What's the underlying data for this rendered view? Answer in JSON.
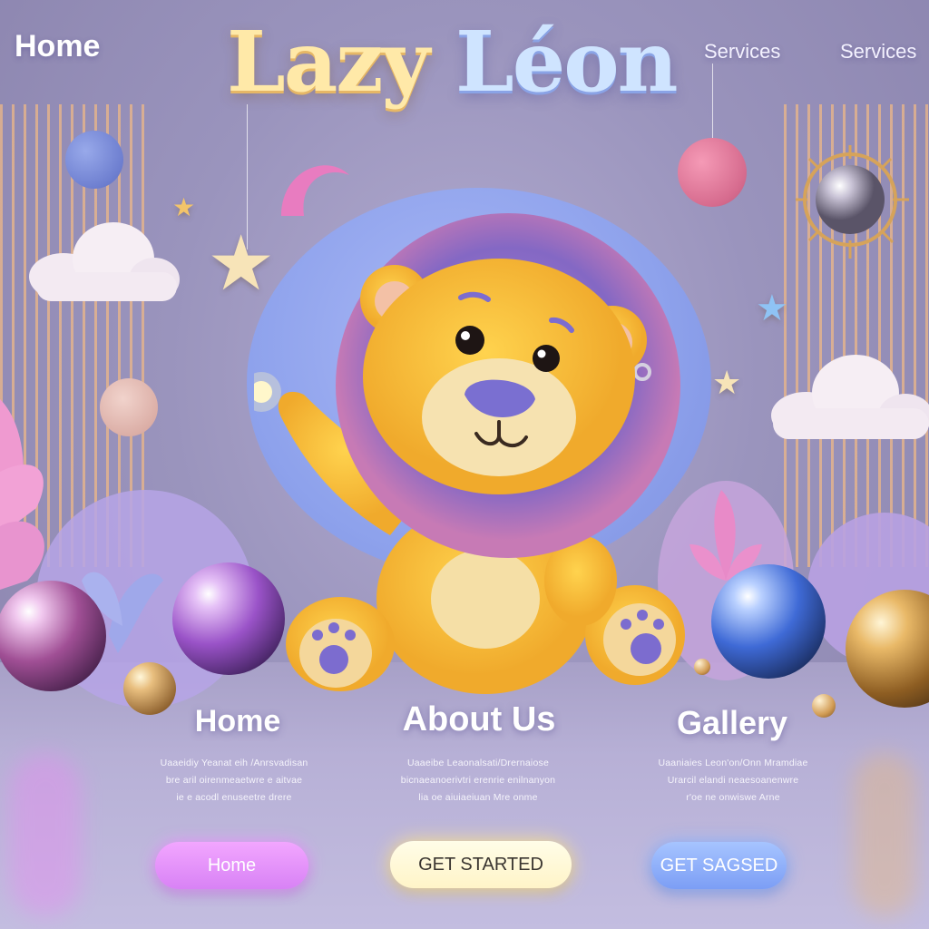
{
  "header": {
    "brand_word_1": "Lazy",
    "brand_word_2": "Léon",
    "nav": [
      {
        "label": "Home"
      },
      {
        "label": "Services"
      },
      {
        "label": "Services"
      }
    ]
  },
  "hero": {
    "mascot": "lion-plush-mascot-icon"
  },
  "sections": [
    {
      "title": "Home",
      "blurb": [
        "Uaaeidiy  Yeanat eih /Anrsvadisan",
        "bre aril oirenmeaetwre e aitvae",
        "ie e acodl enuseetre drere"
      ]
    },
    {
      "title": "About Us",
      "blurb": [
        "Uaaeibe Leaonalsati/Drernaiose",
        "bicnaeanoerivtri erenrie enilnanyon",
        "lia oe aiuiaeiuan Mre onme"
      ]
    },
    {
      "title": "Gallery",
      "blurb": [
        "Uaaniaies Leon'on/Onn Mramdiae",
        "Urarcil elandi neaesoanenwre",
        "r'oe ne onwiswe Arne"
      ]
    }
  ],
  "buttons": {
    "home": "Home",
    "get_started": "GET STARTED",
    "get_started_2": "GET SAGSED"
  },
  "colors": {
    "background": "#9a94bd",
    "lion_fur": "#f8c23e",
    "mane": "#8b72c9",
    "home_button": "#e597f9",
    "get_started_button": "#fff6cf",
    "get_button": "#8fb0fa"
  }
}
